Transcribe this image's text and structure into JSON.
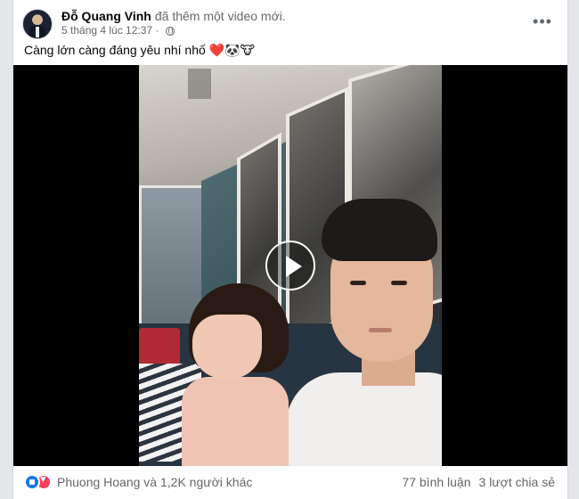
{
  "post": {
    "author": "Đỗ Quang Vinh",
    "action": "đã thêm một video mới.",
    "timestamp": "5 tháng 4 lúc 12:37",
    "privacy_icon": "globe-icon",
    "caption": "Càng lớn càng đáng yêu nhí nhố ❤️🐼🐮"
  },
  "video": {
    "play_icon": "play-icon"
  },
  "reactions": {
    "icons": [
      "like-icon",
      "love-icon"
    ],
    "summary": "Phuong Hoang và 1,2K người khác",
    "comments": "77 bình luận",
    "shares": "3 lượt chia sẻ"
  },
  "colors": {
    "like": "#1877f2",
    "love": "#f33e58",
    "secondary_text": "#65676b"
  }
}
